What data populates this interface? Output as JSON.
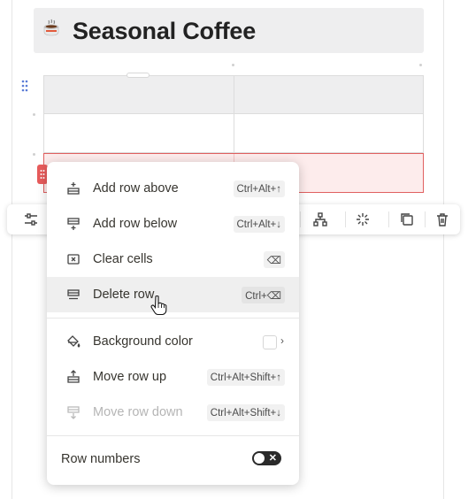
{
  "title": {
    "emoji": "☕",
    "text": "Seasonal Coffee"
  },
  "table": {
    "rows": 3,
    "cols": 2,
    "selected_row": 3
  },
  "toolbar": {
    "items": [
      {
        "icon": "sliders-icon"
      },
      {
        "icon": "network-icon"
      },
      {
        "icon": "sparkle-icon"
      },
      {
        "icon": "duplicate-icon"
      },
      {
        "icon": "trash-icon"
      }
    ]
  },
  "menu": {
    "items": [
      {
        "label": "Add row above",
        "shortcut": "Ctrl+Alt+↑",
        "icon": "insert-row-above-icon"
      },
      {
        "label": "Add row below",
        "shortcut": "Ctrl+Alt+↓",
        "icon": "insert-row-below-icon"
      },
      {
        "label": "Clear cells",
        "shortcut": "⌫",
        "icon": "clear-cells-icon"
      },
      {
        "label": "Delete row",
        "shortcut": "Ctrl+⌫",
        "icon": "delete-row-icon"
      },
      {
        "label": "Background color",
        "icon": "paint-bucket-icon"
      },
      {
        "label": "Move row up",
        "shortcut": "Ctrl+Alt+Shift+↑",
        "icon": "move-up-icon"
      },
      {
        "label": "Move row down",
        "shortcut": "Ctrl+Alt+Shift+↓",
        "icon": "move-down-icon"
      }
    ],
    "row_numbers": {
      "label": "Row numbers",
      "enabled": false
    }
  },
  "colors": {
    "selection_border": "#e06060",
    "selection_fill": "#fdecec",
    "handle": "#e85c5c"
  }
}
